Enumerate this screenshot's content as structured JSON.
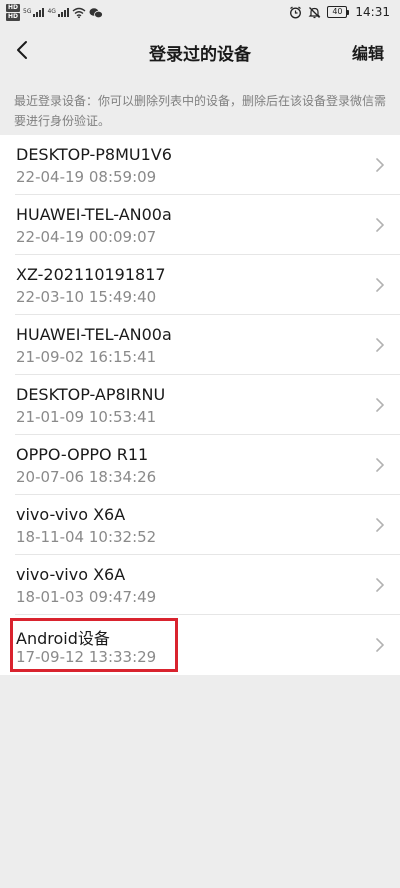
{
  "status_bar": {
    "hd_badges": [
      "HD",
      "HD"
    ],
    "signal_labels": [
      "5G",
      "4G"
    ],
    "battery": "40",
    "time": "14:31"
  },
  "nav": {
    "title": "登录过的设备",
    "edit_label": "编辑"
  },
  "description": "最近登录设备：你可以删除列表中的设备，删除后在该设备登录微信需要进行身份验证。",
  "devices": [
    {
      "name": "DESKTOP-P8MU1V6",
      "time": "22-04-19 08:59:09"
    },
    {
      "name": "HUAWEI-TEL-AN00a",
      "time": "22-04-19 00:09:07"
    },
    {
      "name": "XZ-202110191817",
      "time": "22-03-10 15:49:40"
    },
    {
      "name": "HUAWEI-TEL-AN00a",
      "time": "21-09-02 16:15:41"
    },
    {
      "name": "DESKTOP-AP8IRNU",
      "time": "21-01-09 10:53:41"
    },
    {
      "name": "OPPO-OPPO R11",
      "time": "20-07-06 18:34:26"
    },
    {
      "name": "vivo-vivo X6A",
      "time": "18-11-04 10:32:52"
    },
    {
      "name": "vivo-vivo X6A",
      "time": "18-01-03 09:47:49"
    },
    {
      "name": "Android设备",
      "time": "17-09-12 13:33:29"
    }
  ],
  "highlight": {
    "color": "#d9232e",
    "device_index": 8
  },
  "colors": {
    "background": "#ededed",
    "list_background": "#ffffff",
    "secondary_text": "#8a8a8a"
  }
}
